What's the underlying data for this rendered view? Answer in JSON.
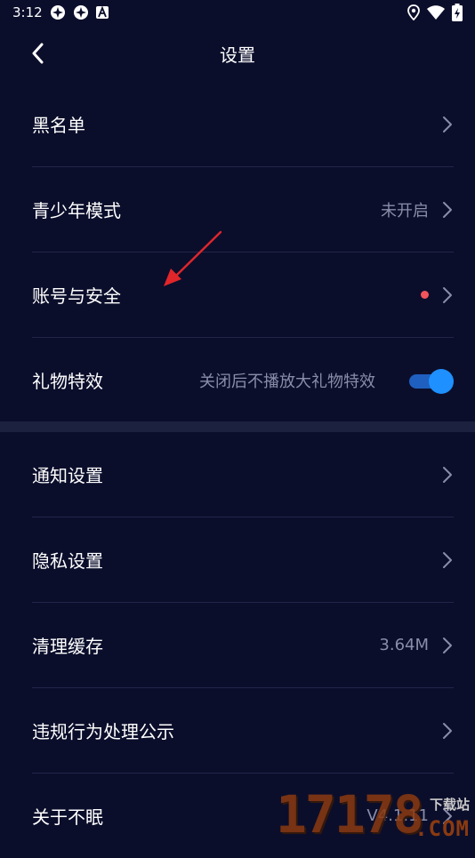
{
  "status_bar": {
    "time": "3:12",
    "icons_left": [
      "app-icon-1",
      "app-icon-2",
      "a-icon"
    ],
    "icons_right": [
      "location-icon",
      "wifi-icon",
      "battery-icon"
    ]
  },
  "nav": {
    "title": "设置",
    "back_icon": "chevron-left-icon"
  },
  "group1": [
    {
      "label": "黑名单",
      "value": "",
      "indicator": "chevron"
    },
    {
      "label": "青少年模式",
      "value": "未开启",
      "indicator": "chevron"
    },
    {
      "label": "账号与安全",
      "value": "",
      "indicator": "dot+chevron"
    },
    {
      "label": "礼物特效",
      "value": "关闭后不播放大礼物特效",
      "indicator": "toggle",
      "toggle_on": true
    }
  ],
  "group2": [
    {
      "label": "通知设置",
      "value": ""
    },
    {
      "label": "隐私设置",
      "value": ""
    },
    {
      "label": "清理缓存",
      "value": "3.64M"
    },
    {
      "label": "违规行为处理公示",
      "value": ""
    },
    {
      "label": "关于不眠",
      "value": "V4.1.11"
    }
  ],
  "watermark": {
    "digits": "17178",
    "sub": "下载站",
    "com": ".COM"
  },
  "colors": {
    "background": "#0b0e2b",
    "divider": "#222548",
    "band": "#1d2140",
    "secondary_text": "#8a8da8",
    "dot": "#f2545b",
    "toggle": "#1e90ff",
    "annotation_arrow": "#e0262b"
  }
}
